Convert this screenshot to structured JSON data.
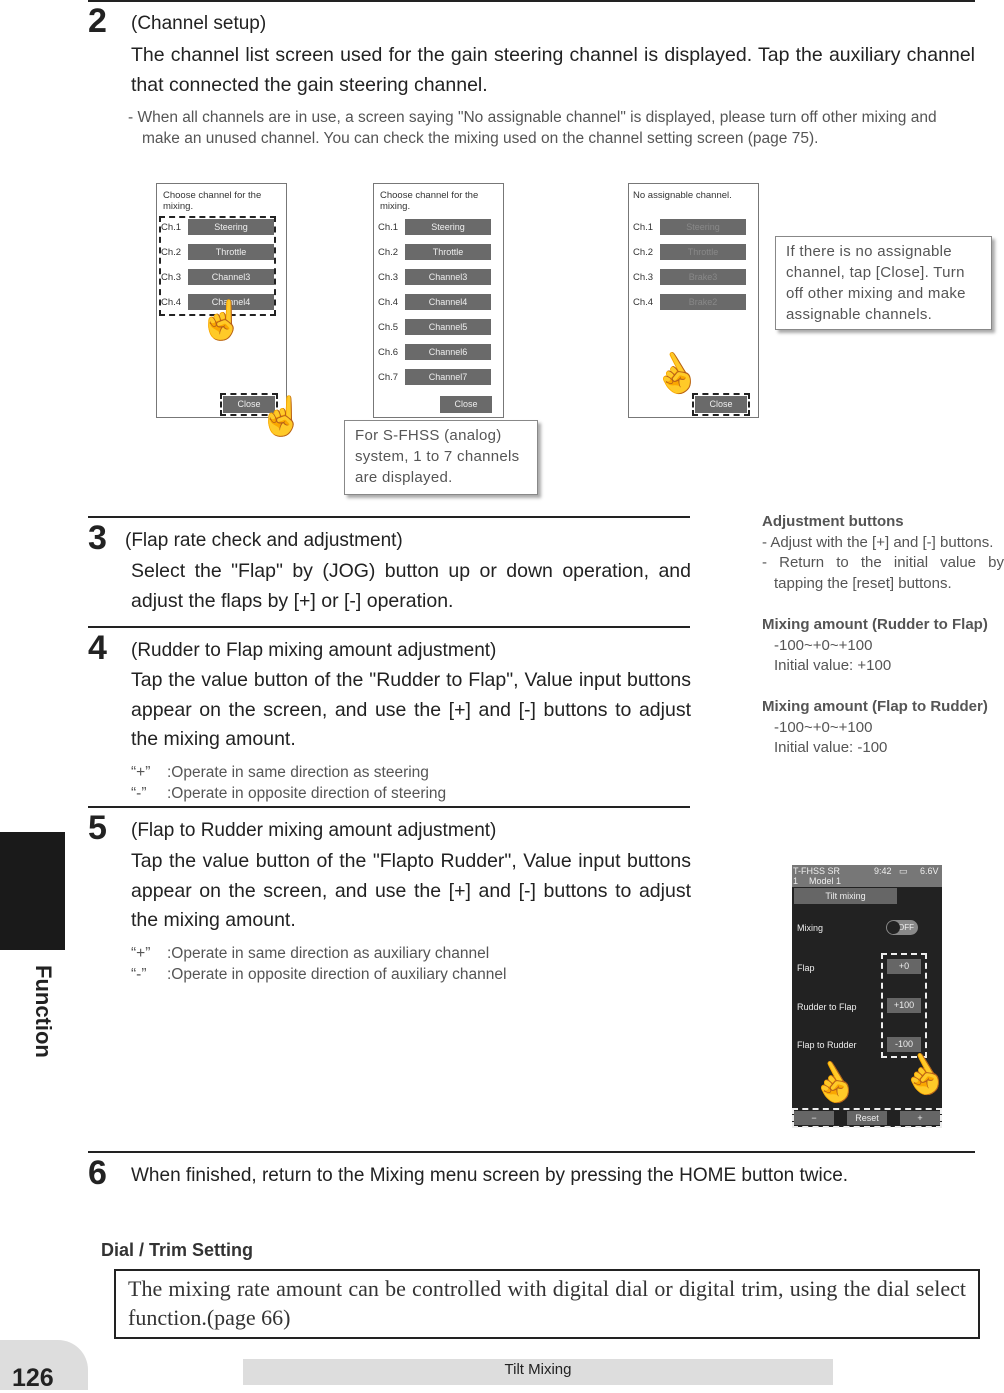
{
  "sections": {
    "s2": {
      "num": "2",
      "title": "(Channel setup)",
      "body": "The channel list screen used for the gain steering channel is displayed. Tap the auxiliary channel that connected the gain steering channel.",
      "note": "- When all channels are in use, a screen saying \"No assignable channel\" is displayed, please turn off other mixing and make an unused channel. You can check the mixing used on the channel setting screen (page 75)."
    },
    "s3": {
      "num": "3",
      "title": "(Flap rate check and adjustment)",
      "body": "Select the \"Flap\" by (JOG) button up or down operation, and adjust the flaps by [+] or [-] operation."
    },
    "s4": {
      "num": "4",
      "title": "(Rudder to Flap mixing amount adjustment)",
      "body": "Tap the value button of the \"Rudder to Flap\", Value input buttons appear on the screen, and use the [+] and [-] buttons to adjust the mixing amount.",
      "notes": [
        {
          "k": "“+”",
          "v": ":Operate in same direction as steering"
        },
        {
          "k": "“-”",
          "v": ":Operate in opposite direction of steering"
        }
      ]
    },
    "s5": {
      "num": "5",
      "title": "(Flap to Rudder mixing amount adjustment)",
      "body": "Tap the value button of the \"Flapto Rudder\", Value input buttons appear on the screen, and use the [+] and [-] buttons to adjust the mixing amount.",
      "notes": [
        {
          "k": "“+”",
          "v": ":Operate in same direction as auxiliary channel"
        },
        {
          "k": "“-”",
          "v": ":Operate in opposite direction of auxiliary channel"
        }
      ]
    },
    "s6": {
      "num": "6",
      "body": "When finished, return to the Mixing menu screen by pressing the HOME button twice."
    }
  },
  "screens": [
    {
      "header": "Choose channel for the mixing.",
      "rows": [
        [
          "Ch.1",
          "Steering"
        ],
        [
          "Ch.2",
          "Throttle"
        ],
        [
          "Ch.3",
          "Channel3"
        ],
        [
          "Ch.4",
          "Channel4"
        ]
      ],
      "close": "Close"
    },
    {
      "header": "Choose channel for the mixing.",
      "rows": [
        [
          "Ch.1",
          "Steering"
        ],
        [
          "Ch.2",
          "Throttle"
        ],
        [
          "Ch.3",
          "Channel3"
        ],
        [
          "Ch.4",
          "Channel4"
        ],
        [
          "Ch.5",
          "Channel5"
        ],
        [
          "Ch.6",
          "Channel6"
        ],
        [
          "Ch.7",
          "Channel7"
        ]
      ],
      "close": "Close"
    },
    {
      "header": "No assignable channel.",
      "rows": [
        [
          "Ch.1",
          "Steering"
        ],
        [
          "Ch.2",
          "Throttle"
        ],
        [
          "Ch.3",
          "Brake3"
        ],
        [
          "Ch.4",
          "Brake2"
        ]
      ],
      "close": "Close"
    }
  ],
  "callouts": {
    "no_assignable": "If there is no assignable channel, tap [Close]. Turn off other mixing and make assignable  channels.",
    "sfhss": "For S-FHSS (analog) system, 1 to 7 channels are displayed."
  },
  "sidebar": {
    "adj_title": "Adjustment buttons",
    "adj_1": "- Adjust with the [+] and [-] buttons.",
    "adj_2": "- Return to the initial value by tapping the [reset] buttons.",
    "rf_title": "Mixing amount (Rudder to Flap)",
    "rf_range": "-100~+0~+100",
    "rf_init": "Initial value: +100",
    "fr_title": "Mixing amount (Flap to Rudder)",
    "fr_range": "-100~+0~+100",
    "fr_init": "Initial value: -100"
  },
  "phone": {
    "system": "T-FHSS SR",
    "time": "9:42",
    "voltage": "6.6V",
    "model_num": "1",
    "model": "Model 1",
    "title": "Tilt mixing",
    "mixing_label": "Mixing",
    "mixing_state": "OFF",
    "rows": [
      {
        "label": "Flap",
        "value": "+0"
      },
      {
        "label": "Rudder to Flap",
        "value": "+100"
      },
      {
        "label": "Flap to Rudder",
        "value": "-100"
      }
    ],
    "minus": "−",
    "reset": "Reset",
    "plus": "+"
  },
  "dial": {
    "title": "Dial / Trim Setting",
    "text": "The mixing rate amount can be controlled with digital dial or digital trim, using the dial select function.(page 66)"
  },
  "footer": {
    "page": "126",
    "chapter": "Tilt Mixing",
    "side_tab": "Function"
  }
}
